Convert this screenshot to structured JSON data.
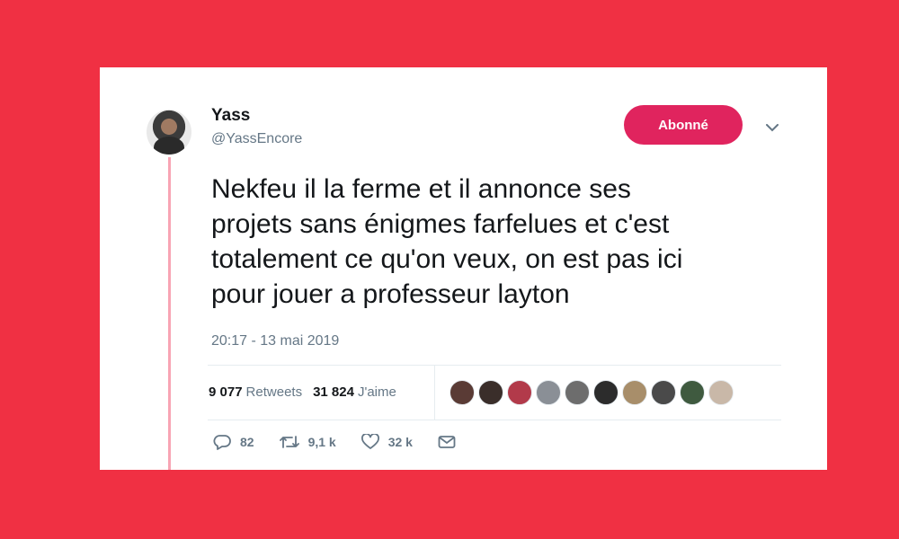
{
  "tweet": {
    "author_name": "Yass",
    "author_handle": "@YassEncore",
    "follow_label": "Abonné",
    "text": "Nekfeu il la ferme et il annonce ses\nprojets sans énigmes farfelues et c'est\ntotalement ce qu'on veux, on est pas ici\npour jouer a professeur layton",
    "timestamp": "20:17 - 13 mai 2019"
  },
  "stats": {
    "retweets_count": "9 077",
    "retweets_label": "Retweets",
    "likes_count": "31 824",
    "likes_label": "J'aime"
  },
  "likers": [
    {
      "name": "liker-avatar-1",
      "color": "#5a3b35"
    },
    {
      "name": "liker-avatar-2",
      "color": "#3a2e2a"
    },
    {
      "name": "liker-avatar-3",
      "color": "#b23a4a"
    },
    {
      "name": "liker-avatar-4",
      "color": "#8a8f96"
    },
    {
      "name": "liker-avatar-5",
      "color": "#6d6d6d"
    },
    {
      "name": "liker-avatar-6",
      "color": "#2c2c2c"
    },
    {
      "name": "liker-avatar-7",
      "color": "#a88e6a"
    },
    {
      "name": "liker-avatar-8",
      "color": "#4a4a4a"
    },
    {
      "name": "liker-avatar-9",
      "color": "#3f5a3f"
    },
    {
      "name": "liker-avatar-10",
      "color": "#c9b8a8"
    }
  ],
  "actions": {
    "replies": "82",
    "retweets": "9,1 k",
    "likes": "32 k"
  },
  "colors": {
    "background": "#f03043",
    "follow_button": "#e0245e",
    "thread_line": "#f8a5b4",
    "secondary_text": "#657786"
  }
}
